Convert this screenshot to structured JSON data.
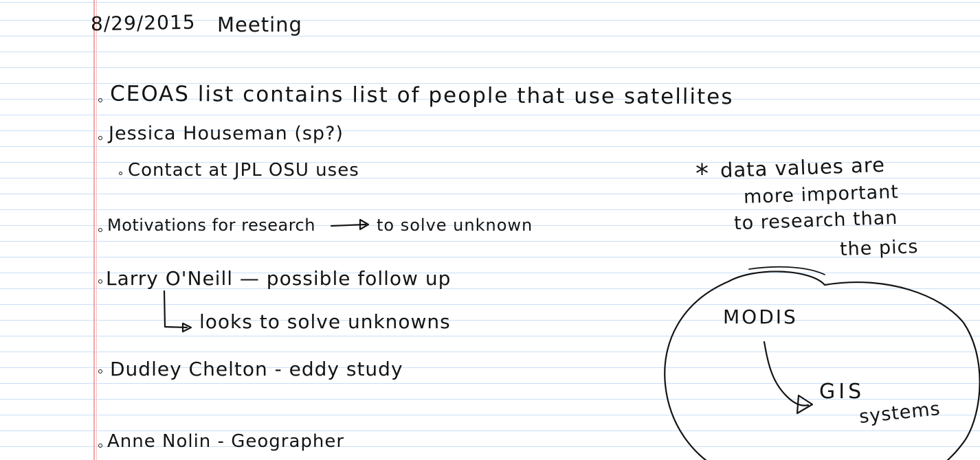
{
  "header": {
    "date": "8/29/2015",
    "title": "Meeting"
  },
  "notes": [
    {
      "text": "CEOAS list contains list of people that use satellites"
    },
    {
      "text": "Jessica Houseman (sp?)"
    },
    {
      "text": "Contact at JPL OSU uses"
    },
    {
      "text": "Motivations for research"
    },
    {
      "text": "to solve unknown"
    },
    {
      "text": "Larry O'Neill — possible follow up"
    },
    {
      "text": "looks to solve unknowns"
    },
    {
      "text": "Dudley Chelton - eddy study"
    },
    {
      "text": "Anne Nolin - Geographer"
    }
  ],
  "side_note": {
    "asterisk": "*",
    "lines": [
      "data values are",
      "more important",
      "to research than",
      "the pics"
    ]
  },
  "diagram": {
    "source": "MODIS",
    "target_line1": "GIS",
    "target_line2": "systems"
  },
  "colors": {
    "ink": "#141414",
    "rule_line": "#c9dff6",
    "margin_line": "#f2a5a5",
    "paper": "#ffffff"
  }
}
